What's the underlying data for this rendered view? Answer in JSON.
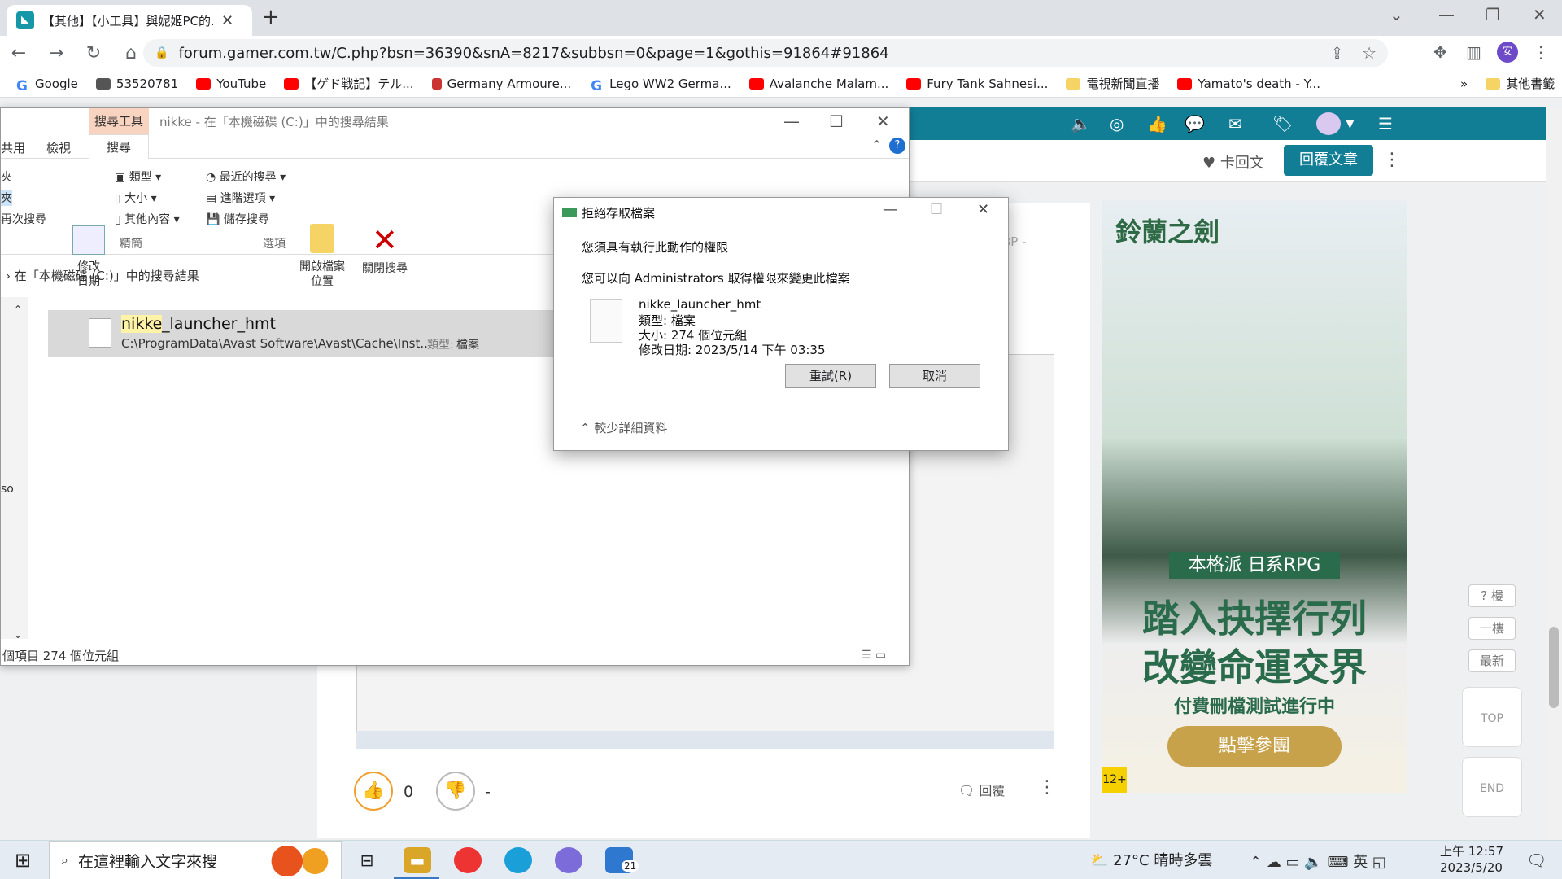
{
  "browser": {
    "tab_title": "【其他】【小工具】與妮姬PC的...",
    "url": "forum.gamer.com.tw/C.php?bsn=36390&snA=8217&subbsn=0&page=1&gothis=91864#91864",
    "avatar_letter": "安",
    "bookmarks": [
      {
        "label": "Google",
        "icon": "google-icon"
      },
      {
        "label": "53520781",
        "icon": "avatar-icon"
      },
      {
        "label": "YouTube",
        "icon": "youtube-icon"
      },
      {
        "label": "【ゲド戦記】テル...",
        "icon": "youtube-icon"
      },
      {
        "label": "Germany Armoure...",
        "icon": "shield-icon"
      },
      {
        "label": "Lego WW2 Germa...",
        "icon": "google-icon"
      },
      {
        "label": "Avalanche Malam...",
        "icon": "youtube-icon"
      },
      {
        "label": "Fury Tank Sahnesi...",
        "icon": "youtube-icon"
      },
      {
        "label": "電視新聞直播",
        "icon": "folder-icon"
      },
      {
        "label": "Yamato's death - Y...",
        "icon": "youtube-icon"
      }
    ],
    "bookmarks_more": "»",
    "other_bookmarks": "其他書籤"
  },
  "forum": {
    "kahui": "♥ 卡回文",
    "reply_button": "回覆文章",
    "bp_label": "BP -",
    "like_count": "0",
    "dislike_count": "-",
    "reply_link": "回覆",
    "floatnav": {
      "floor": "? 樓",
      "first": "一樓",
      "latest": "最新",
      "top": "TOP",
      "end": "END"
    }
  },
  "ad": {
    "logo": "鈴蘭之劍",
    "tagline": "本格派 日系RPG",
    "headline1": "踏入抉擇行列",
    "headline2": "改變命運交界",
    "subline": "付費刪檔測試進行中",
    "cta": "點擊參團",
    "rating": "12+"
  },
  "explorer": {
    "context_tab": "搜尋工具",
    "title": "nikke - 在「本機磁碟 (C:)」中的搜尋結果",
    "tabs": [
      "共用",
      "檢視",
      "搜尋"
    ],
    "ribbon": {
      "modify_date": "修改日期",
      "kind": "類型",
      "size": "大小",
      "other_props": "其他內容",
      "refine_group": "精簡",
      "recent": "最近的搜尋",
      "advanced": "進階選項",
      "save_search": "儲存搜尋",
      "options_group": "選項",
      "open_location": "開啟檔案位置",
      "close_search": "關閉搜尋",
      "left_partial": [
        "夾",
        "夾",
        "再次搜尋"
      ]
    },
    "breadcrumb": "在「本機磁碟 (C:)」中的搜尋結果",
    "result": {
      "highlight": "nikke",
      "name_rest": "_launcher_hmt",
      "path": "C:\\ProgramData\\Avast Software\\Avast\\Cache\\Inst...",
      "type_label": "類型:",
      "type_value": "檔案"
    },
    "status": "個項目  274 個位元組",
    "left_text": "so"
  },
  "dialog": {
    "title": "拒絕存取檔案",
    "msg1": "您須具有執行此動作的權限",
    "msg2": "您可以向 Administrators 取得權限來變更此檔案",
    "file_name": "nikke_launcher_hmt",
    "file_type": "類型: 檔案",
    "file_size": "大小: 274 個位元組",
    "file_date": "修改日期: 2023/5/14 下午 03:35",
    "retry": "重試(R)",
    "cancel": "取消",
    "less_info": "較少詳細資料"
  },
  "taskbar": {
    "search_placeholder": "在這裡輸入文字來搜",
    "badge": "21",
    "weather": "27°C  晴時多雲",
    "ime": "英",
    "time": "上午 12:57",
    "date": "2023/5/20"
  }
}
